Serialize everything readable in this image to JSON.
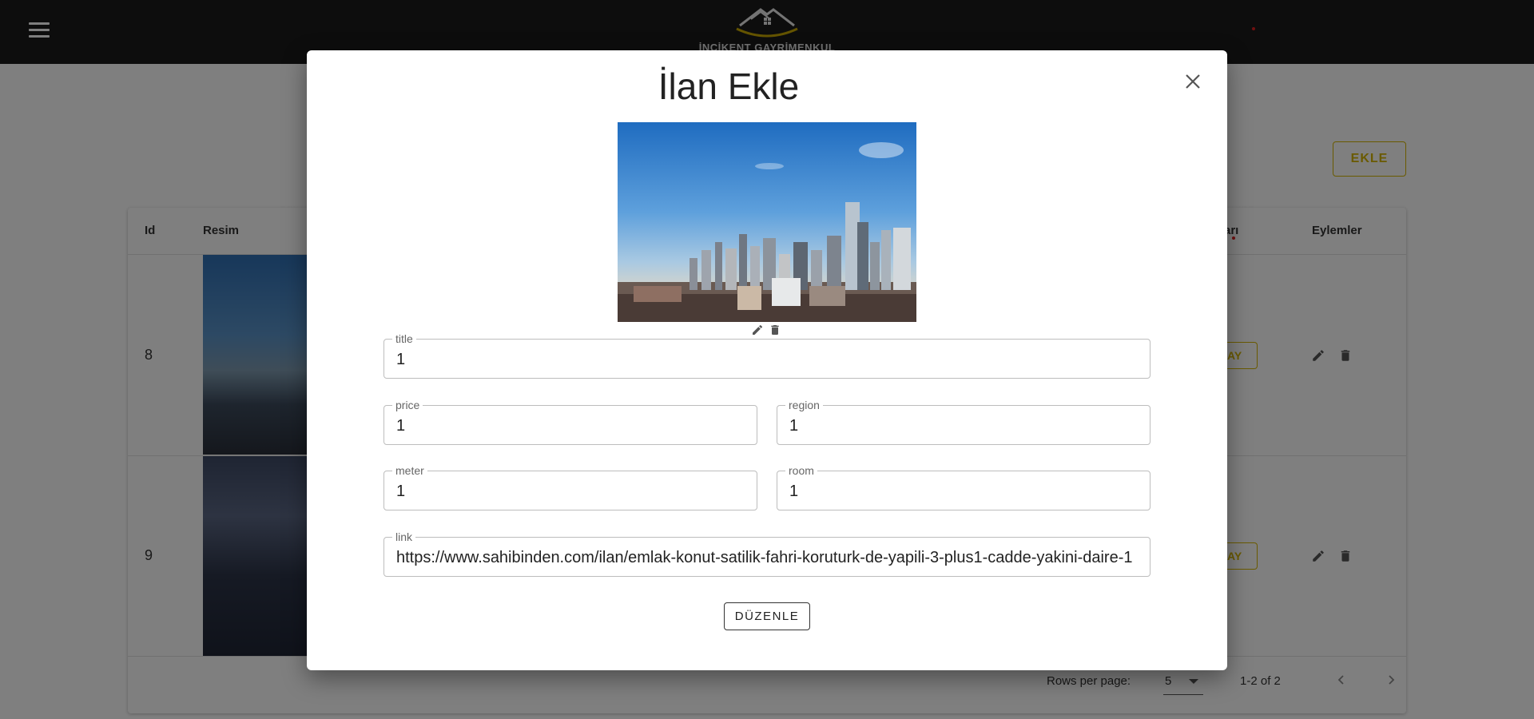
{
  "app": {
    "logo_text": "İNCİKENT GAYRİMENKUL",
    "add_button_label": "EKLE"
  },
  "table": {
    "headers": {
      "id": "Id",
      "image": "Resim",
      "partial_header": "arı",
      "actions": "Eylemler"
    },
    "rows": [
      {
        "id": "8",
        "status_fragment": "AY"
      },
      {
        "id": "9",
        "status_fragment": "AY"
      }
    ],
    "pagination": {
      "rows_per_page_label": "Rows per page:",
      "rows_per_page_value": "5",
      "range_text": "1-2 of 2"
    }
  },
  "dialog": {
    "title": "İlan Ekle",
    "fields": {
      "title": {
        "label": "title",
        "value": "1"
      },
      "price": {
        "label": "price",
        "value": "1"
      },
      "region": {
        "label": "region",
        "value": "1"
      },
      "meter": {
        "label": "meter",
        "value": "1"
      },
      "room": {
        "label": "room",
        "value": "1"
      },
      "link": {
        "label": "link",
        "value": "https://www.sahibinden.com/ilan/emlak-konut-satilik-fahri-koruturk-de-yapili-3-plus1-cadde-yakini-daire-1"
      }
    },
    "submit_label": "DÜZENLE"
  },
  "colors": {
    "accent_gold": "#d4b400",
    "appbar": "#1a1a1a"
  }
}
